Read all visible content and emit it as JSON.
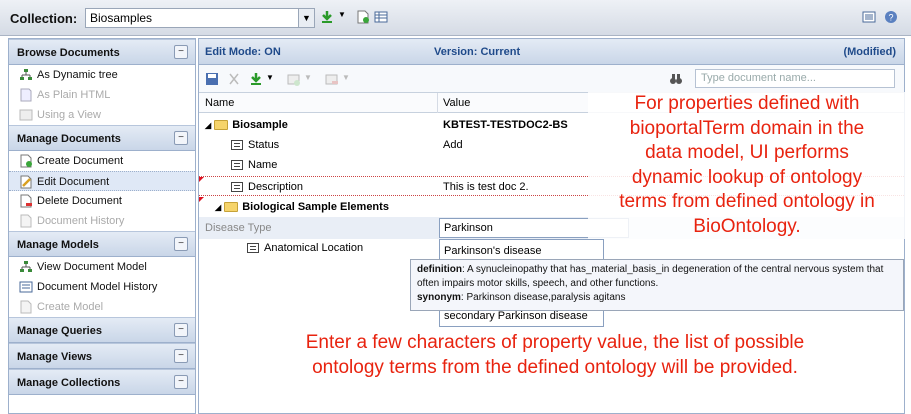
{
  "topbar": {
    "collection_label": "Collection:",
    "collection_value": "Biosamples"
  },
  "sidebar": {
    "sections": [
      {
        "title": "Browse Documents",
        "items": [
          {
            "label": "As Dynamic tree",
            "state": "normal"
          },
          {
            "label": "As Plain HTML",
            "state": "disabled"
          },
          {
            "label": "Using a View",
            "state": "disabled"
          }
        ]
      },
      {
        "title": "Manage Documents",
        "items": [
          {
            "label": "Create Document",
            "state": "normal"
          },
          {
            "label": "Edit Document",
            "state": "selected"
          },
          {
            "label": "Delete Document",
            "state": "normal"
          },
          {
            "label": "Document History",
            "state": "disabled"
          }
        ]
      },
      {
        "title": "Manage Models",
        "items": [
          {
            "label": "View Document Model",
            "state": "normal"
          },
          {
            "label": "Document Model History",
            "state": "normal"
          },
          {
            "label": "Create Model",
            "state": "disabled"
          }
        ]
      },
      {
        "title": "Manage Queries",
        "items": []
      },
      {
        "title": "Manage Views",
        "items": []
      },
      {
        "title": "Manage Collections",
        "items": []
      }
    ]
  },
  "main": {
    "edit_mode": "Edit Mode: ON",
    "version": "Version: Current",
    "modified": "(Modified)",
    "search_placeholder": "Type document name...",
    "col_name": "Name",
    "col_value": "Value",
    "rows": {
      "biosample": {
        "name": "Biosample",
        "value": "KBTEST-TESTDOC2-BS"
      },
      "status": {
        "name": "Status",
        "value": "Add"
      },
      "name": {
        "name": "Name",
        "value": ""
      },
      "description": {
        "name": "Description",
        "value": "This is test doc 2."
      },
      "elements": {
        "name": "Biological Sample Elements"
      },
      "disease_type": {
        "name": "Disease Type",
        "value": "Parkinson"
      },
      "anatomical": {
        "name": "Anatomical Location"
      }
    },
    "suggestions": {
      "first": "Parkinson's disease",
      "last": "secondary Parkinson disease"
    },
    "tooltip": {
      "definition_label": "definition",
      "definition_text": ": A synucleinopathy that has_material_basis_in degeneration of the central nervous system that often impairs motor skills, speech, and other functions.",
      "synonym_label": "synonym",
      "synonym_text": ": Parkinson disease,paralysis agitans"
    }
  },
  "annotations": {
    "top": [
      "For properties defined with",
      "bioportalTerm domain in the",
      "data model, UI performs",
      "dynamic lookup of ontology",
      "terms from defined ontology in",
      "BioOntology."
    ],
    "bottom": [
      "Enter a few characters of property value, the list of possible",
      "ontology terms from the defined ontology will be provided."
    ]
  }
}
